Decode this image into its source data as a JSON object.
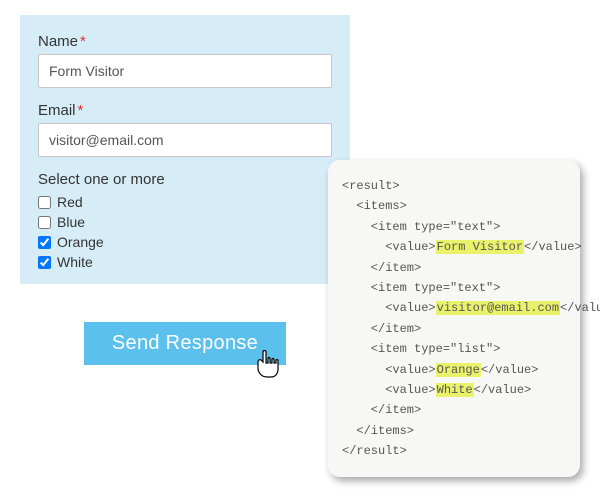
{
  "form": {
    "name_label": "Name",
    "name_value": "Form Visitor",
    "email_label": "Email",
    "email_value": "visitor@email.com",
    "required_mark": "*",
    "select_label": "Select one or more",
    "options": [
      {
        "label": "Red",
        "checked": false
      },
      {
        "label": "Blue",
        "checked": false
      },
      {
        "label": "Orange",
        "checked": true
      },
      {
        "label": "White",
        "checked": true
      }
    ],
    "submit_label": "Send Response"
  },
  "code": {
    "l0": "<result>",
    "l1": "  <items>",
    "l2a": "    <item type=\"text\">",
    "l2b_pre": "      <value>",
    "l2b_hl": "Form Visitor",
    "l2b_post": "</value>",
    "l2c": "    </item>",
    "l3a": "    <item type=\"text\">",
    "l3b_pre": "      <value>",
    "l3b_hl": "visitor@email.com",
    "l3b_post": "</value>",
    "l3c": "    </item>",
    "l4a": "    <item type=\"list\">",
    "l4b_pre": "      <value>",
    "l4b_hl": "Orange",
    "l4b_post": "</value>",
    "l4c_pre": "      <value>",
    "l4c_hl": "White",
    "l4c_post": "</value>",
    "l4d": "    </item>",
    "l5": "  </items>",
    "l6": "</result>"
  }
}
